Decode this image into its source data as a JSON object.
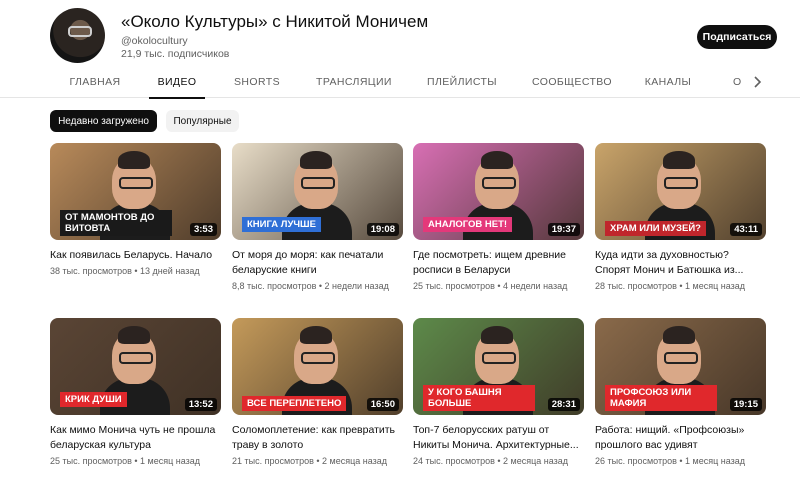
{
  "channel": {
    "title": "«Около Культуры» с Никитой Моничем",
    "handle": "@okoloculturу",
    "subscribers": "21,9 тыс. подписчиков",
    "subscribe_label": "Подписаться"
  },
  "tabs": [
    {
      "label": "ГЛАВНАЯ"
    },
    {
      "label": "ВИДЕО"
    },
    {
      "label": "SHORTS"
    },
    {
      "label": "ТРАНСЛЯЦИИ"
    },
    {
      "label": "ПЛЕЙЛИСТЫ"
    },
    {
      "label": "СООБЩЕСТВО"
    },
    {
      "label": "КАНАЛЫ"
    },
    {
      "label": "О"
    }
  ],
  "active_tab": "ВИДЕО",
  "chips": {
    "active": "Недавно загружено",
    "idle": "Популярные"
  },
  "videos": [
    {
      "title": "Как появилась Беларусь. Начало",
      "meta": "38 тыс. просмотров • 13 дней назад",
      "duration": "3:53",
      "badge": "ОТ МАМОНТОВ ДО ВИТОВТА",
      "badge_color": "#1a1a1a",
      "bg": "#b88a5a"
    },
    {
      "title": "От моря до моря: как печатали беларуские книги",
      "meta": "8,8 тыс. просмотров • 2 недели назад",
      "duration": "19:08",
      "badge": "КНИГА ЛУЧШЕ",
      "badge_color": "#2f6fd6",
      "bg": "#e8ddc8"
    },
    {
      "title": "Где посмотреть: ищем древние росписи в Беларуси",
      "meta": "25 тыс. просмотров • 4 недели назад",
      "duration": "19:37",
      "badge": "АНАЛОГОВ НЕТ!",
      "badge_color": "#e4387a",
      "bg": "#d86fb4"
    },
    {
      "title": "Куда идти за духовностью? Спорят Монич и Батюшка из...",
      "meta": "28 тыс. просмотров • 1 месяц назад",
      "duration": "43:11",
      "badge": "ХРАМ ИЛИ МУЗЕЙ?",
      "badge_color": "#c0262c",
      "bg": "#c9a46a"
    },
    {
      "title": "Как мимо Монича чуть не прошла беларуская культура",
      "meta": "25 тыс. просмотров • 1 месяц назад",
      "duration": "13:52",
      "badge": "КРИК ДУШИ",
      "badge_color": "#e0282c",
      "bg": "#5a4535"
    },
    {
      "title": "Соломоплетение: как превратить траву в золото",
      "meta": "21 тыс. просмотров • 2 месяца назад",
      "duration": "16:50",
      "badge": "ВСЕ ПЕРЕПЛЕТЕНО",
      "badge_color": "#e0282c",
      "bg": "#c49a5a"
    },
    {
      "title": "Топ-7 белорусских ратуш от Никиты Монича. Архитектурные...",
      "meta": "24 тыс. просмотров • 2 месяца назад",
      "duration": "28:31",
      "badge": "У КОГО БАШНЯ БОЛЬШЕ",
      "badge_color": "#e0282c",
      "bg": "#5d8a4a"
    },
    {
      "title": "Работа: нищий. «Профсоюзы» прошлого вас удивят",
      "meta": "26 тыс. просмотров • 1 месяц назад",
      "duration": "19:15",
      "badge": "ПРОФСОЮЗ ИЛИ МАФИЯ",
      "badge_color": "#e0282c",
      "bg": "#8a6a4a"
    }
  ]
}
